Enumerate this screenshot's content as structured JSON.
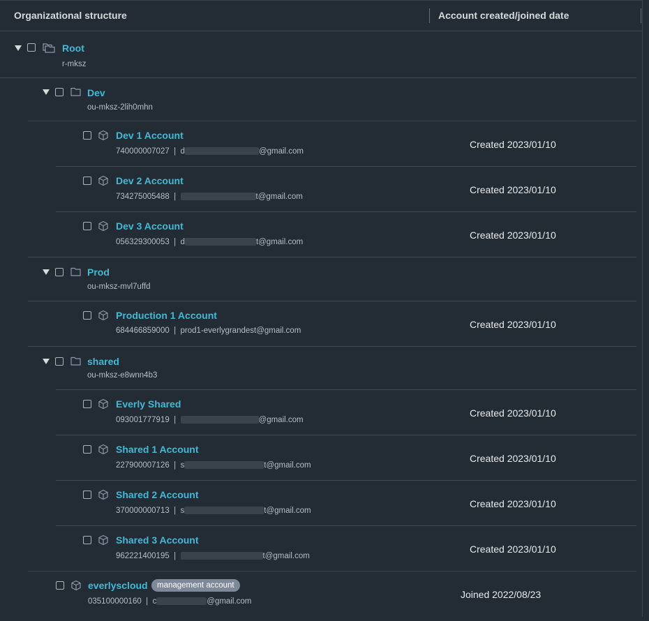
{
  "table": {
    "header_structure": "Organizational structure",
    "header_date": "Account created/joined date"
  },
  "root": {
    "name": "Root",
    "id": "r-mksz"
  },
  "ous": [
    {
      "name": "Dev",
      "id": "ou-mksz-2lih0mhn",
      "accounts": [
        {
          "name": "Dev 1 Account",
          "num": "740000007027",
          "email": "@gmail.com",
          "email_prefix": "d",
          "date": "Created 2023/01/10"
        },
        {
          "name": "Dev 2 Account",
          "num": "734275005488",
          "email": "t@gmail.com",
          "email_prefix": "",
          "date": "Created 2023/01/10"
        },
        {
          "name": "Dev 3 Account",
          "num": "056329300053",
          "email": "t@gmail.com",
          "email_prefix": "d",
          "date": "Created 2023/01/10"
        }
      ]
    },
    {
      "name": "Prod",
      "id": "ou-mksz-mvl7uffd",
      "accounts": [
        {
          "name": "Production 1 Account",
          "num": "684466859000",
          "email": "prod1-everlygrandest@gmail.com",
          "email_prefix": "",
          "date": "Created 2023/01/10"
        }
      ]
    },
    {
      "name": "shared",
      "id": "ou-mksz-e8wnn4b3",
      "accounts": [
        {
          "name": "Everly Shared",
          "num": "093001777919",
          "email": "@gmail.com",
          "email_prefix": "",
          "date": "Created 2023/01/10"
        },
        {
          "name": "Shared 1 Account",
          "num": "227900007126",
          "email": "t@gmail.com",
          "email_prefix": "s",
          "date": "Created 2023/01/10"
        },
        {
          "name": "Shared 2 Account",
          "num": "370000000713",
          "email": "t@gmail.com",
          "email_prefix": "s",
          "date": "Created 2023/01/10"
        },
        {
          "name": "Shared 3 Account",
          "num": "962221400195",
          "email": "t@gmail.com",
          "email_prefix": "",
          "date": "Created 2023/01/10"
        }
      ]
    }
  ],
  "management": {
    "name": "everlyscloud",
    "badge": "management account",
    "num": "035100000160",
    "email": "@gmail.com",
    "email_prefix": "c",
    "date": "Joined 2022/08/23"
  }
}
